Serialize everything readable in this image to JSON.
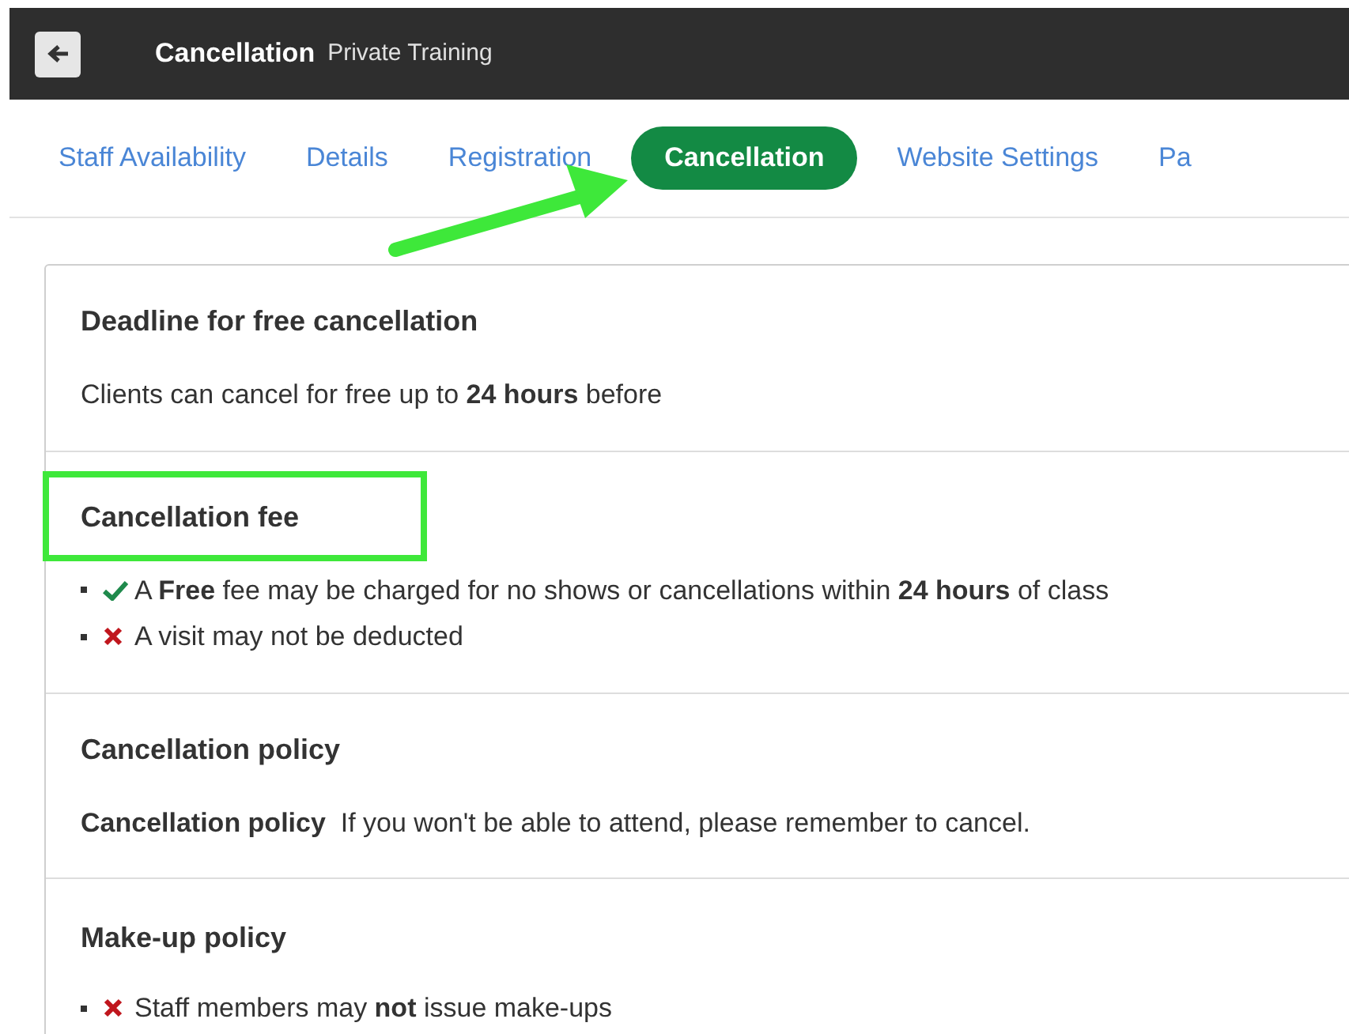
{
  "header": {
    "title": "Cancellation",
    "subtitle": "Private Training"
  },
  "tabs": [
    {
      "label": "Staff Availability",
      "selected": false
    },
    {
      "label": "Details",
      "selected": false
    },
    {
      "label": "Registration",
      "selected": false
    },
    {
      "label": "Cancellation",
      "selected": true
    },
    {
      "label": "Website Settings",
      "selected": false
    },
    {
      "label": "Pa",
      "selected": false
    }
  ],
  "sections": [
    {
      "title": "Deadline for free cancellation",
      "highlighted": false,
      "kind": "text",
      "text": "Clients can cancel for free up to **24 hours** before"
    },
    {
      "title": "Cancellation fee",
      "highlighted": true,
      "kind": "list",
      "items": [
        {
          "allowed": true,
          "text": "A **Free** fee may be charged for no shows or cancellations within **24 hours** of class"
        },
        {
          "allowed": false,
          "text": "A visit may not be deducted"
        }
      ]
    },
    {
      "title": "Cancellation policy",
      "highlighted": false,
      "kind": "text",
      "text": "**Cancellation policy**  If you won't be able to attend, please remember to cancel."
    },
    {
      "title": "Make-up policy",
      "highlighted": false,
      "kind": "list",
      "items": [
        {
          "allowed": false,
          "text": "Staff members may **not** issue make-ups"
        }
      ]
    }
  ]
}
